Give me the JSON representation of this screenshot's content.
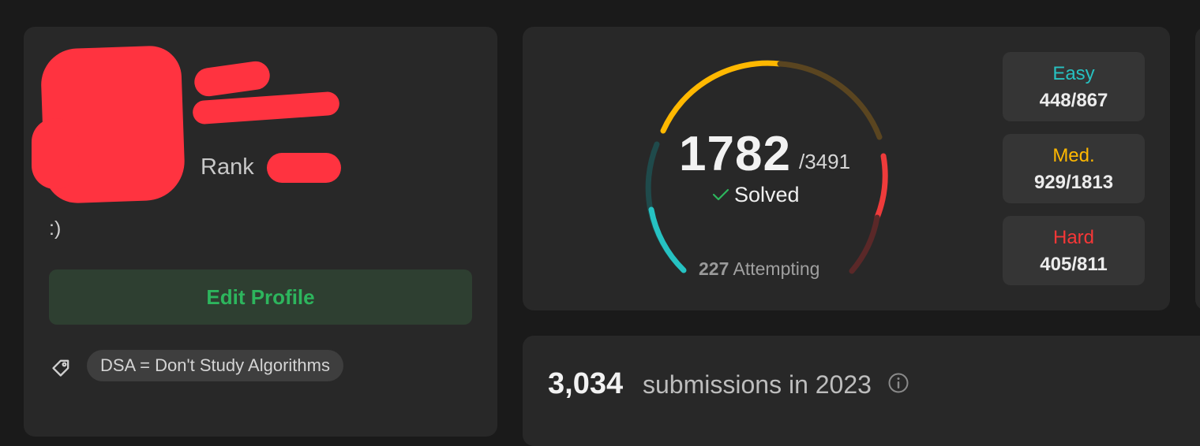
{
  "profile": {
    "rank_label": "Rank",
    "bio": ":)",
    "edit_button": "Edit Profile",
    "tag_icon": "tag-icon",
    "tag": "DSA = Don't Study Algorithms"
  },
  "stats": {
    "solved": "1782",
    "total": "/3491",
    "solved_label": "Solved",
    "attempting_count": "227",
    "attempting_label": "Attempting",
    "easy": {
      "label": "Easy",
      "value": "448/867",
      "color": "#27c1c1"
    },
    "medium": {
      "label": "Med.",
      "value": "929/1813",
      "color": "#ffb800"
    },
    "hard": {
      "label": "Hard",
      "value": "405/811",
      "color": "#f63737"
    }
  },
  "submissions": {
    "count": "3,034",
    "text": "submissions in 2023",
    "info_icon": "info-icon"
  }
}
